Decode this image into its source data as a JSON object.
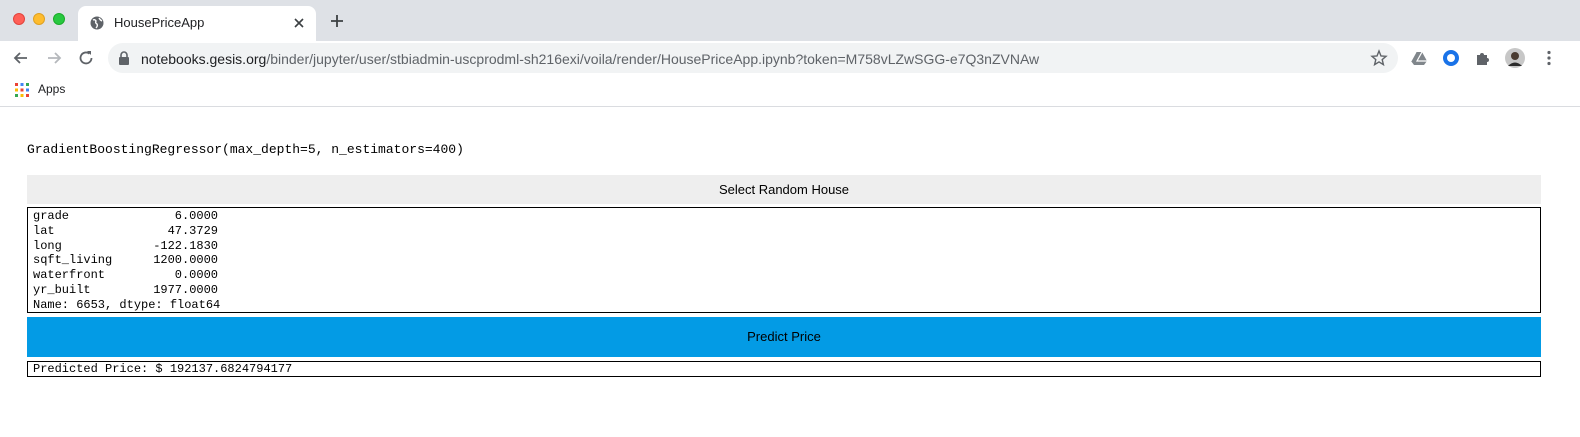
{
  "browser": {
    "tab_title": "HousePriceApp",
    "url_host": "notebooks.gesis.org",
    "url_path": "/binder/jupyter/user/stbiadmin-uscprodml-sh216exi/voila/render/HousePriceApp.ipynb?token=M758vLZwSGG-e7Q3nZVNAw",
    "bookmarks": {
      "apps_label": "Apps"
    },
    "icons": [
      "globe-icon",
      "close-icon",
      "plus-icon",
      "back-icon",
      "forward-icon",
      "reload-icon",
      "lock-icon",
      "star-icon",
      "drive-icon",
      "extension-icon",
      "puzzle-icon",
      "avatar",
      "menu-icon",
      "apps-grid-icon"
    ]
  },
  "page": {
    "model_repr": "GradientBoostingRegressor(max_depth=5, n_estimators=400)",
    "select_button_label": "Select Random House",
    "house_rows": [
      {
        "key": "grade",
        "value": "6.0000"
      },
      {
        "key": "lat",
        "value": "47.3729"
      },
      {
        "key": "long",
        "value": "-122.1830"
      },
      {
        "key": "sqft_living",
        "value": "1200.0000"
      },
      {
        "key": "waterfront",
        "value": "0.0000"
      },
      {
        "key": "yr_built",
        "value": "1977.0000"
      }
    ],
    "house_footer": "Name: 6653, dtype: float64",
    "predict_button_label": "Predict Price",
    "predicted_price": "Predicted Price: $ 192137.6824794177"
  },
  "colors": {
    "predict_button": "#039be5",
    "select_button": "#eeeeee"
  }
}
